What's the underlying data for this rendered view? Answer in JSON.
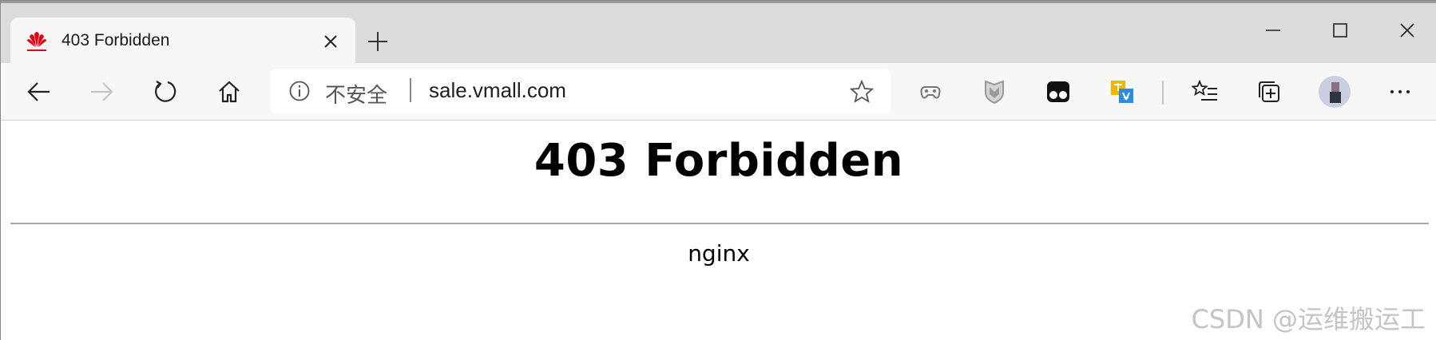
{
  "tab": {
    "title": "403 Forbidden",
    "favicon": "huawei-logo-icon",
    "favicon_color": "#e60012"
  },
  "window_controls": [
    "minimize-icon",
    "maximize-icon",
    "close-icon"
  ],
  "toolbar": {
    "nav_icons": [
      "back-arrow-icon",
      "forward-arrow-icon",
      "refresh-icon",
      "home-icon"
    ],
    "extension_icons": [
      "extension-gamepad-icon",
      "extension-shield-icon",
      "extension-tampermonkey-icon",
      "extension-translate-icon",
      "favorites-list-icon",
      "collections-icon",
      "more-menu-icon"
    ]
  },
  "address_bar": {
    "security_label": "不安全",
    "url": "sale.vmall.com"
  },
  "page": {
    "heading": "403 Forbidden",
    "server": "nginx"
  },
  "watermark": "CSDN @运维搬运工"
}
